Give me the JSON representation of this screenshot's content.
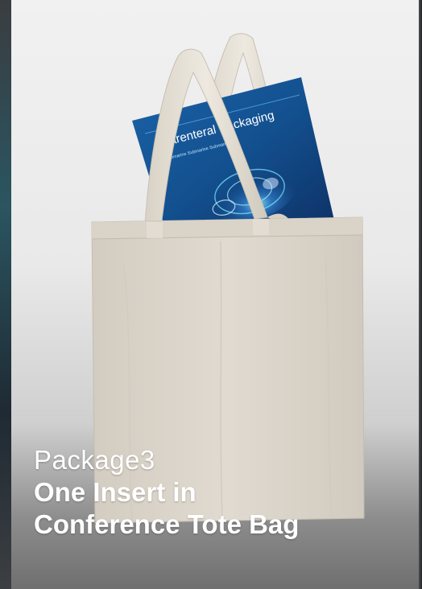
{
  "package": {
    "label": "Package3",
    "headline_line1": "One Insert in",
    "headline_line2": "Conference Tote Bag"
  },
  "magazine": {
    "title": "Parenteral Packaging",
    "subtitle": "Submarine Submarine Submarine"
  },
  "colors": {
    "caption_text": "#ffffff",
    "magazine_blue": "#1e6fb2",
    "bag_canvas": "#dcd6cc"
  }
}
